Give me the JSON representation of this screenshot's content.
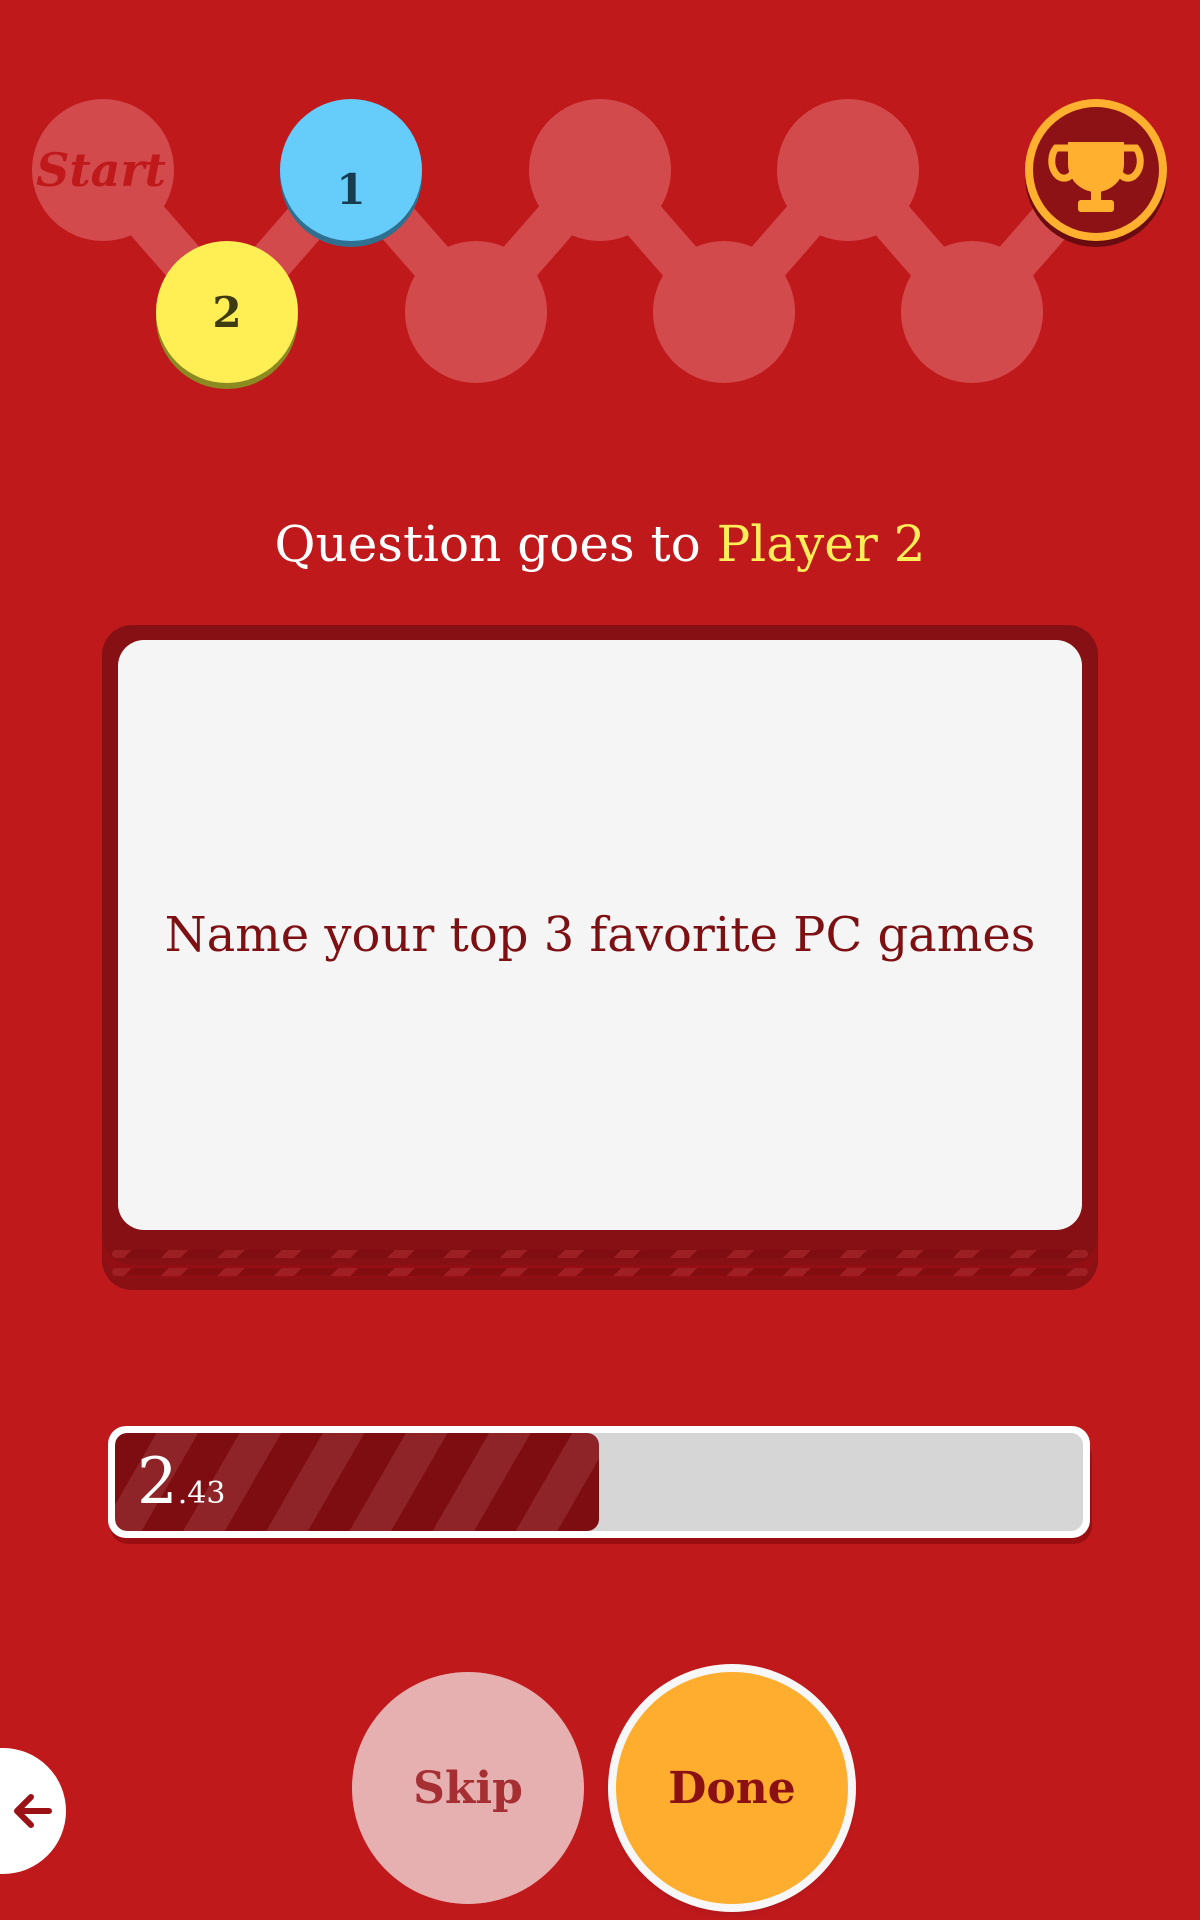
{
  "board": {
    "start_label": "Start",
    "player1_token": "1",
    "player2_token": "2",
    "colors": {
      "background": "#c0191c",
      "empty_space": "#d34a4c",
      "player1": "#66cdfb",
      "player2": "#ffef55",
      "trophy_ring": "#ffb02e",
      "trophy_fill": "#8c1216"
    },
    "icons": {
      "finish": "trophy-icon"
    }
  },
  "heading": {
    "prefix": "Question goes to",
    "player": "Player 2"
  },
  "card": {
    "question": "Name your top 3 favorite PC games"
  },
  "timer": {
    "value_main": "2",
    "value_fraction": ".43",
    "progress": 0.5
  },
  "buttons": {
    "skip_label": "Skip",
    "done_label": "Done",
    "back_icon": "arrow-left-icon"
  }
}
